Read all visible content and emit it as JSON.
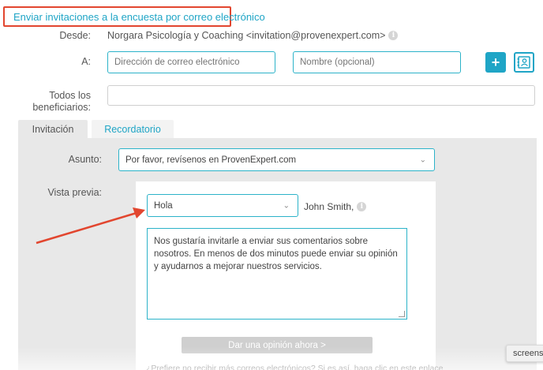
{
  "header": {
    "title": "Enviar invitaciones a la encuesta por correo electrónico"
  },
  "from": {
    "label": "Desde:",
    "value": "Norgara Psicología y Coaching <invitation@provenexpert.com>"
  },
  "to": {
    "label": "A:",
    "email_placeholder": "Dirección de correo electrónico",
    "name_placeholder": "Nombre (opcional)",
    "add_icon": "plus-icon",
    "contacts_icon": "address-book-icon"
  },
  "all_recipients": {
    "label_line1": "Todos los",
    "label_line2": "beneficiarios:"
  },
  "tabs": [
    {
      "label": "Invitación",
      "active": true
    },
    {
      "label": "Recordatorio",
      "active": false
    }
  ],
  "subject": {
    "label": "Asunto:",
    "value": "Por favor, revísenos en ProvenExpert.com"
  },
  "preview": {
    "label": "Vista previa:",
    "greeting": "Hola",
    "recipient": "John Smith,",
    "body": "Nos gustaría invitarle a enviar sus comentarios sobre nosotros. En menos de dos minutos puede enviar su opinión y ayudarnos a mejorar nuestros servicios.",
    "cta": "Dar una opinión ahora >",
    "footer": "¿Prefiere no recibir más correos electrónicos? Si es así, haga clic en este enlace"
  },
  "screens_chip": {
    "label": "screens"
  },
  "colors": {
    "accent": "#1fa5c6",
    "highlight": "#e2462f",
    "panel": "#e8e8e8"
  }
}
